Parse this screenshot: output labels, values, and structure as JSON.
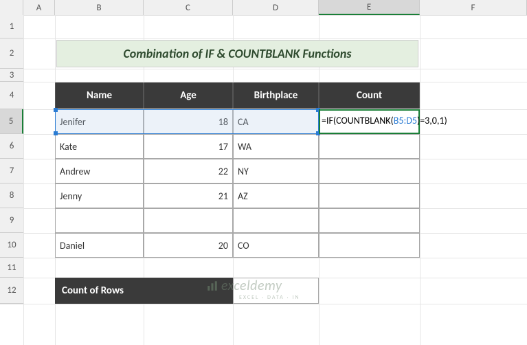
{
  "columns": [
    "A",
    "B",
    "C",
    "D",
    "E",
    "F"
  ],
  "rows": [
    "1",
    "2",
    "3",
    "4",
    "5",
    "6",
    "7",
    "8",
    "9",
    "10",
    "11",
    "12"
  ],
  "title": "Combination of IF & COUNTBLANK Functions",
  "headers": {
    "name": "Name",
    "age": "Age",
    "birthplace": "Birthplace",
    "count": "Count"
  },
  "data": [
    {
      "name": "Jenifer",
      "age": "18",
      "birthplace": "CA"
    },
    {
      "name": "Kate",
      "age": "17",
      "birthplace": "WA"
    },
    {
      "name": "Andrew",
      "age": "22",
      "birthplace": "NY"
    },
    {
      "name": "Jenny",
      "age": "21",
      "birthplace": "AZ"
    },
    {
      "name": "",
      "age": "",
      "birthplace": ""
    },
    {
      "name": "Daniel",
      "age": "20",
      "birthplace": "CO"
    }
  ],
  "count_label": "Count of Rows",
  "formula": {
    "prefix": "=IF(COUNTBLANK(",
    "ref": "B5:D5",
    "suffix": ")=3,0,1)"
  },
  "watermark": {
    "brand": "exceldemy",
    "sub": "EXCEL · DATA · IN"
  },
  "chart_data": {
    "type": "table",
    "title": "Combination of IF & COUNTBLANK Functions",
    "columns": [
      "Name",
      "Age",
      "Birthplace",
      "Count"
    ],
    "rows": [
      [
        "Jenifer",
        18,
        "CA",
        "=IF(COUNTBLANK(B5:D5)=3,0,1)"
      ],
      [
        "Kate",
        17,
        "WA",
        ""
      ],
      [
        "Andrew",
        22,
        "NY",
        ""
      ],
      [
        "Jenny",
        21,
        "AZ",
        ""
      ],
      [
        "",
        "",
        "",
        ""
      ],
      [
        "Daniel",
        20,
        "CO",
        ""
      ]
    ],
    "summary": {
      "label": "Count of Rows",
      "value": ""
    }
  }
}
